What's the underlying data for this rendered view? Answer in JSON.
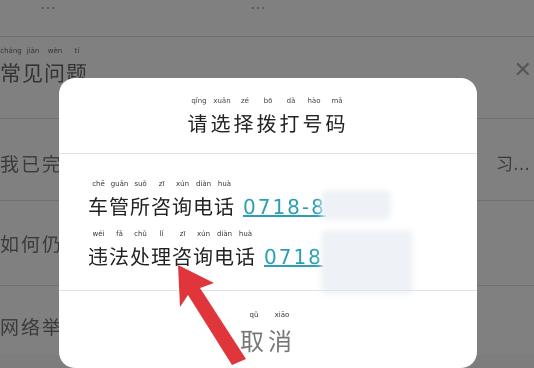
{
  "background": {
    "top_row": [
      "…",
      "…"
    ],
    "section_heading": {
      "chars": [
        {
          "char": "常",
          "pinyin": "cháng"
        },
        {
          "char": "见",
          "pinyin": "jiàn"
        },
        {
          "char": "问",
          "pinyin": "wèn"
        },
        {
          "char": "题",
          "pinyin": "tí"
        }
      ]
    },
    "rows": [
      "我已完",
      "如何仍",
      "网络举"
    ],
    "row_tail": "习…"
  },
  "dialog": {
    "title": {
      "chars": [
        {
          "char": "请",
          "pinyin": "qǐng"
        },
        {
          "char": "选",
          "pinyin": "xuǎn"
        },
        {
          "char": "择",
          "pinyin": "zé"
        },
        {
          "char": "拨",
          "pinyin": "bō"
        },
        {
          "char": "打",
          "pinyin": "dǎ"
        },
        {
          "char": "号",
          "pinyin": "hào"
        },
        {
          "char": "码",
          "pinyin": "mǎ"
        }
      ]
    },
    "options": [
      {
        "label_chars": [
          {
            "char": "车",
            "pinyin": "chē"
          },
          {
            "char": "管",
            "pinyin": "guǎn"
          },
          {
            "char": "所",
            "pinyin": "suǒ"
          },
          {
            "char": "咨",
            "pinyin": "zī"
          },
          {
            "char": "询",
            "pinyin": "xún"
          },
          {
            "char": "电",
            "pinyin": "diàn"
          },
          {
            "char": "话",
            "pinyin": "huà"
          }
        ],
        "number_visible": "0718-8"
      },
      {
        "label_chars": [
          {
            "char": "违",
            "pinyin": "wéi"
          },
          {
            "char": "法",
            "pinyin": "fǎ"
          },
          {
            "char": "处",
            "pinyin": "chǔ"
          },
          {
            "char": "理",
            "pinyin": "lǐ"
          },
          {
            "char": "咨",
            "pinyin": "zī"
          },
          {
            "char": "询",
            "pinyin": "xún"
          },
          {
            "char": "电",
            "pinyin": "diàn"
          },
          {
            "char": "话",
            "pinyin": "huà"
          }
        ],
        "number_visible": "0718"
      }
    ],
    "cancel": {
      "chars": [
        {
          "char": "取",
          "pinyin": "qǔ"
        },
        {
          "char": "消",
          "pinyin": "xiāo"
        }
      ]
    }
  },
  "colors": {
    "overlay": "#808080",
    "dialog_bg": "#ffffff",
    "phone_link": "#2aa0b5",
    "arrow": "#e0353a"
  },
  "icons": {
    "close": "close-icon",
    "annotation_arrow": "red-arrow-icon"
  }
}
